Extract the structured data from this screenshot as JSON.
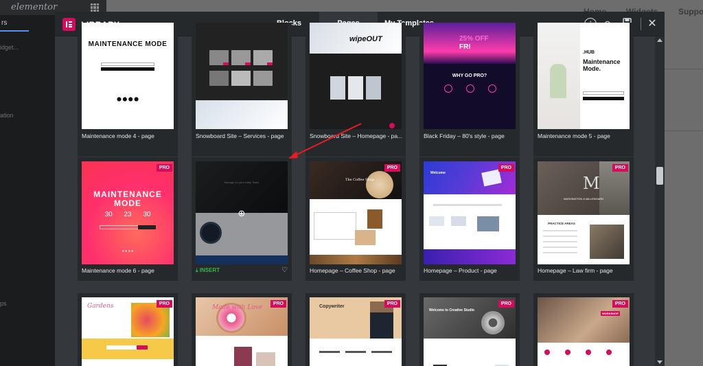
{
  "background": {
    "logo": "elementor",
    "left_tab": "rs",
    "left_texts": [
      "idget...",
      "ation",
      "ps"
    ],
    "nav": [
      "Home",
      "Widgets",
      "Suppo"
    ]
  },
  "library": {
    "title": "LIBRARY",
    "tabs": [
      {
        "label": "Blocks",
        "active": false
      },
      {
        "label": "Pages",
        "active": true
      },
      {
        "label": "My Templates",
        "active": false
      }
    ],
    "actions": {
      "upload": "upload-icon",
      "sync": "sync-icon",
      "save": "save-icon",
      "close": "close-icon"
    }
  },
  "cards": [
    {
      "label": "Maintenance mode 4 - page",
      "pro": false
    },
    {
      "label": "Snowboard Site – Services - page",
      "pro": false
    },
    {
      "label": "Snowboard Site – Homepage - pa...",
      "pro": false
    },
    {
      "label": "Black Friday – 80's style - page",
      "pro": false
    },
    {
      "label": "Maintenance mode 5 - page",
      "pro": false
    },
    {
      "label": "Maintenance mode 6 - page",
      "pro": true
    },
    {
      "label": "",
      "pro": false,
      "hovered": true,
      "insert_label": "INSERT"
    },
    {
      "label": "Homepage – Coffee Shop - page",
      "pro": true
    },
    {
      "label": "Homepage – Product - page",
      "pro": true
    },
    {
      "label": "Homepage – Law firm - page",
      "pro": true
    },
    {
      "label": "",
      "pro": true
    },
    {
      "label": "",
      "pro": true
    },
    {
      "label": "",
      "pro": true
    },
    {
      "label": "",
      "pro": true
    },
    {
      "label": "",
      "pro": true
    }
  ],
  "pro_badge": "PRO",
  "thumb_text": {
    "mm4_title": "MAINTENANCE MODE",
    "mm6_title": "MAINTENANCE MODE",
    "mm6_nums": "30 23 30",
    "hub_label": ".HUB",
    "hub_title": "Maintenance Mode.",
    "wipeout": "wipeOUT",
    "bf_top": "25% OFF",
    "bf_fri": "FRI",
    "bf_why": "WHY GO PRO?",
    "coffee": "The Coffee Shop",
    "law_m": "M",
    "law_firm": "WASHINGTON & MILLENGARD",
    "law_practice": "PRACTICE AREAS",
    "made_love": "Made with Love",
    "copywriter": "Copywriter",
    "web_studio": "Welcome to Creative Studio",
    "workshop": "WORKSHOP",
    "gardens": "Gardens",
    "welcome": "Welcome"
  },
  "colors": {
    "accent": "#d30c5c",
    "insert": "#39b54a",
    "header_bg": "#26292c",
    "modal_bg": "#34383c"
  }
}
